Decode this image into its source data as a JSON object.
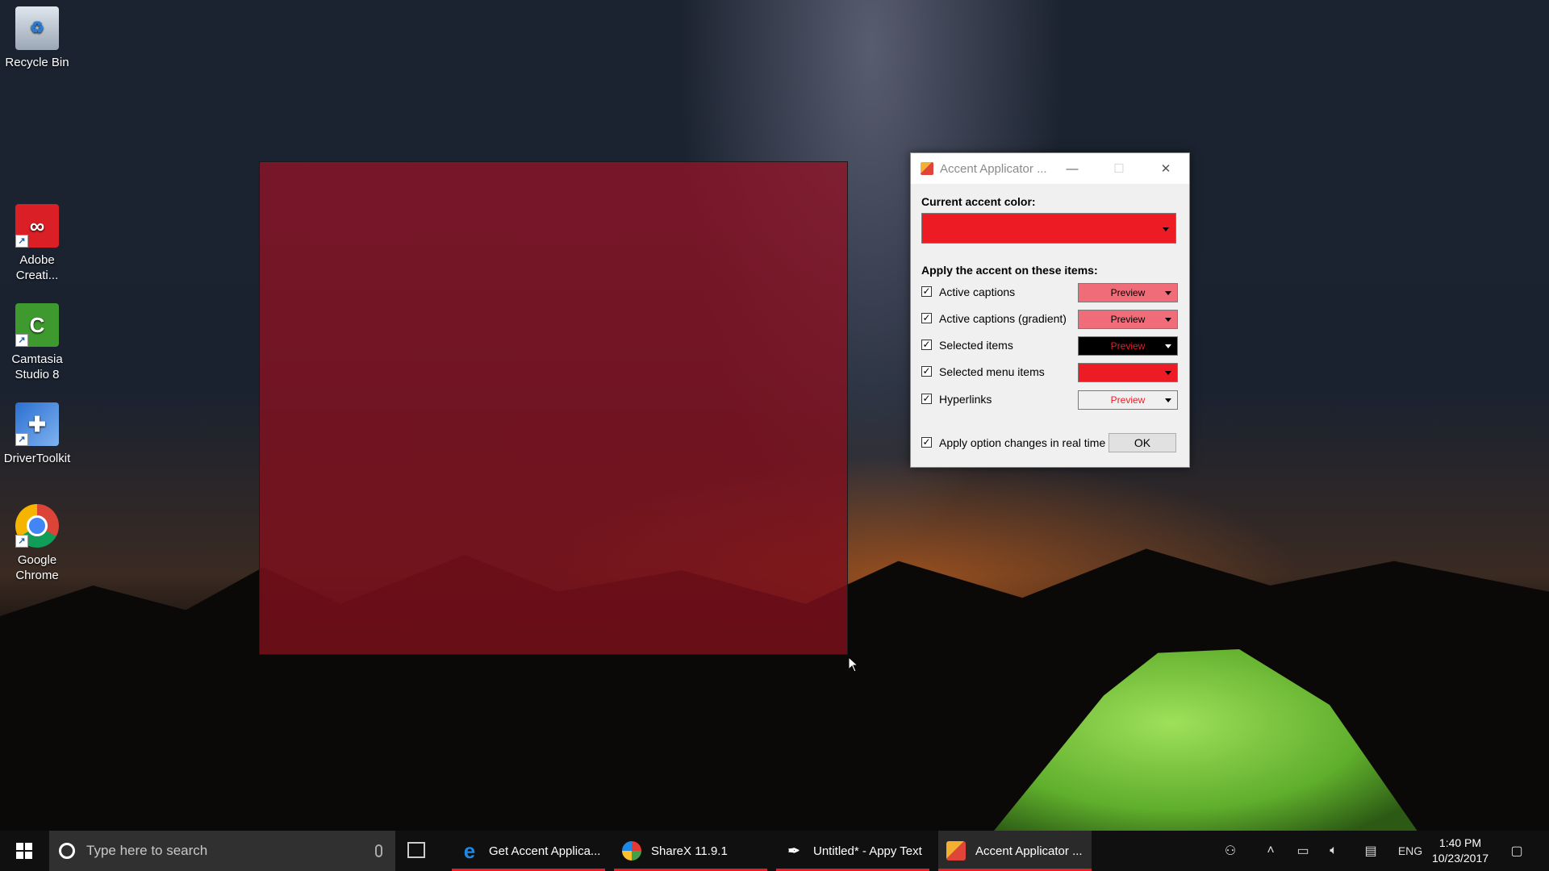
{
  "desktop": {
    "icons": [
      {
        "label": "Recycle Bin",
        "icon": "recycle-bin-icon"
      },
      {
        "label": "Adobe Creati...",
        "icon": "adobe-creative-cloud-icon"
      },
      {
        "label": "Camtasia Studio 8",
        "icon": "camtasia-icon"
      },
      {
        "label": "DriverToolkit",
        "icon": "drivertoolkit-icon"
      },
      {
        "label": "Google Chrome",
        "icon": "chrome-icon"
      }
    ],
    "overlay_color": "#8c1428"
  },
  "dialog": {
    "title": "Accent Applicator ...",
    "minimize": "—",
    "maximize": "☐",
    "close": "✕",
    "current_accent_label": "Current accent color:",
    "accent_color": "#ed1c24",
    "apply_label": "Apply the accent on these items:",
    "items": [
      {
        "label": "Active captions",
        "checked": true,
        "preview": "Preview",
        "bg": "#f06c78",
        "fg": "#000000"
      },
      {
        "label": "Active captions (gradient)",
        "checked": true,
        "preview": "Preview",
        "bg": "#f06c78",
        "fg": "#000000"
      },
      {
        "label": "Selected items",
        "checked": true,
        "preview": "Preview",
        "bg": "#000000",
        "fg": "#ed1c24"
      },
      {
        "label": "Selected menu items",
        "checked": true,
        "preview": "",
        "bg": "#ed1c24",
        "fg": "#000000"
      },
      {
        "label": "Hyperlinks",
        "checked": true,
        "preview": "Preview",
        "bg": "#f0f0f0",
        "fg": "#ed1c24"
      }
    ],
    "realtime_label": "Apply option changes in real time",
    "realtime_checked": true,
    "ok_label": "OK"
  },
  "taskbar": {
    "search_placeholder": "Type here to search",
    "apps": [
      {
        "label": "Get Accent Applica...",
        "icon": "edge-icon",
        "color": "#1e88e5",
        "glyph": "e"
      },
      {
        "label": "ShareX 11.9.1",
        "icon": "sharex-icon",
        "color": "#e53935",
        "glyph": "◉"
      },
      {
        "label": "Untitled* - Appy Text",
        "icon": "appy-text-icon",
        "color": "#101010",
        "glyph": "✒"
      },
      {
        "label": "Accent Applicator ...",
        "icon": "accent-applicator-icon",
        "color": "#f4b030",
        "glyph": "◆"
      }
    ],
    "language": "ENG",
    "time": "1:40 PM",
    "date": "10/23/2017"
  }
}
